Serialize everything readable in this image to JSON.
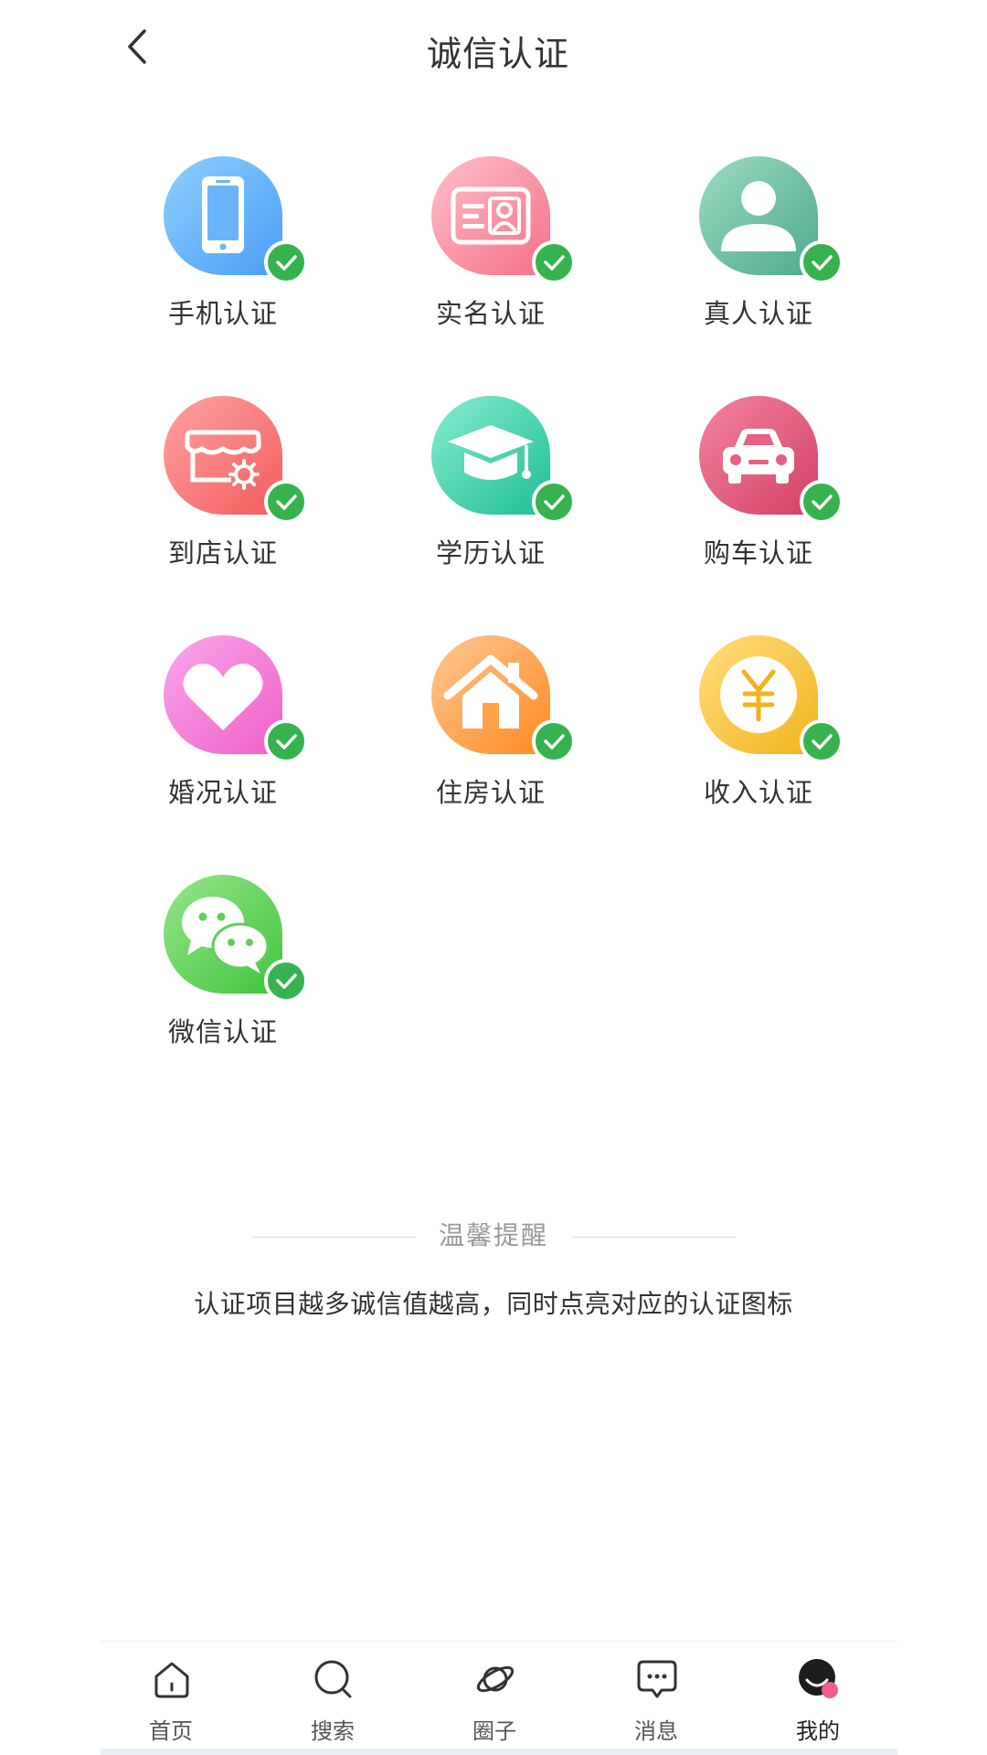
{
  "header": {
    "title": "诚信认证",
    "back_icon": "chevron-left-icon"
  },
  "certifications": [
    {
      "label": "手机认证",
      "icon": "phone-icon",
      "verified": true,
      "colors": [
        "#7cc4ff",
        "#4a9df5"
      ]
    },
    {
      "label": "实名认证",
      "icon": "id-card-icon",
      "verified": true,
      "colors": [
        "#ffb3c2",
        "#f56f85"
      ]
    },
    {
      "label": "真人认证",
      "icon": "person-icon",
      "verified": true,
      "colors": [
        "#8ed7bb",
        "#4fa98b"
      ]
    },
    {
      "label": "到店认证",
      "icon": "store-icon",
      "verified": true,
      "colors": [
        "#ff9a9a",
        "#f25c5c"
      ]
    },
    {
      "label": "学历认证",
      "icon": "graduation-cap-icon",
      "verified": true,
      "colors": [
        "#6fe6c4",
        "#1fbf93"
      ]
    },
    {
      "label": "购车认证",
      "icon": "car-icon",
      "verified": true,
      "colors": [
        "#f07a98",
        "#d44165"
      ]
    },
    {
      "label": "婚况认证",
      "icon": "heart-icon",
      "verified": true,
      "colors": [
        "#f79ee8",
        "#ef5fc7"
      ]
    },
    {
      "label": "住房认证",
      "icon": "house-icon",
      "verified": true,
      "colors": [
        "#ffc08a",
        "#ff8a1f"
      ]
    },
    {
      "label": "收入认证",
      "icon": "yuan-coin-icon",
      "verified": true,
      "colors": [
        "#ffd86a",
        "#f2b21e"
      ]
    },
    {
      "label": "微信认证",
      "icon": "wechat-icon",
      "verified": true,
      "colors": [
        "#8be07e",
        "#3fc43c"
      ]
    }
  ],
  "tip": {
    "title": "温馨提醒",
    "text": "认证项目越多诚信值越高，同时点亮对应的认证图标"
  },
  "tabbar": {
    "items": [
      {
        "label": "首页",
        "icon": "home-icon"
      },
      {
        "label": "搜索",
        "icon": "search-icon"
      },
      {
        "label": "圈子",
        "icon": "planet-icon"
      },
      {
        "label": "消息",
        "icon": "chat-bubble-icon"
      },
      {
        "label": "我的",
        "icon": "profile-avatar-icon",
        "active": true
      }
    ]
  },
  "badge_color": "#36b24f"
}
